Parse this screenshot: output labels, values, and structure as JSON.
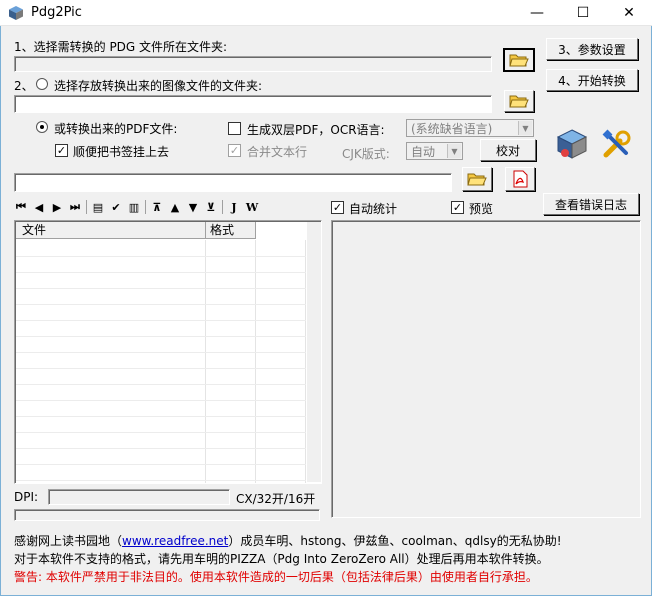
{
  "window": {
    "title": "Pdg2Pic",
    "minimize_glyph": "—",
    "maximize_glyph": "☐",
    "close_glyph": "✕"
  },
  "step1": {
    "label": "1、选择需转换的 PDG 文件所在文件夹:"
  },
  "step2": {
    "label": "选择存放转换出来的图像文件的文件夹:",
    "prefix": "2、"
  },
  "buttons": {
    "settings": "3、参数设置",
    "start": "4、开始转换",
    "proofread": "校对",
    "view_error_log": "查看错误日志"
  },
  "options": {
    "convert_pdf_label": "或转换出来的PDF文件:",
    "bookmark_label": "顺便把书签挂上去",
    "dual_layer_label": "生成双层PDF，OCR语言:",
    "ocr_language_value": "(系统缺省语言)",
    "merge_text_label": "合并文本行",
    "cjk_label": "CJK版式:",
    "cjk_value": "自动",
    "auto_stat_label": "自动统计",
    "preview_label": "预览"
  },
  "file_table": {
    "columns": [
      "文件",
      "格式"
    ],
    "rows": []
  },
  "status": {
    "dpi_label": "DPI:",
    "size_value": "CX/32开/16开"
  },
  "footer": {
    "thanks_prefix": "感谢网上读书园地（",
    "thanks_link": "www.readfree.net",
    "thanks_suffix": "）成员车明、hstong、伊兹鱼、coolman、qdlsy的无私协助!",
    "pizza_note": "对于本软件不支持的格式，请先用车明的PIZZA（Pdg Into ZeroZero All）处理后再用本软件转换。",
    "warning": "警告: 本软件严禁用于非法目的。使用本软件造成的一切后果（包括法律后果）由使用者自行承担。"
  },
  "colors": {
    "accent": "#7bb0d6",
    "warning": "#e00000",
    "link": "#0000cc"
  }
}
